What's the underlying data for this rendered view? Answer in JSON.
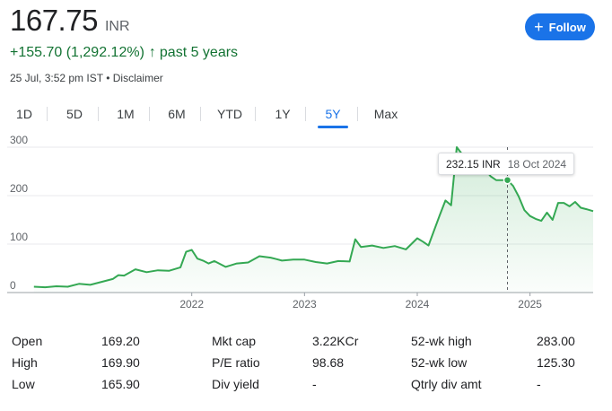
{
  "quote": {
    "price": "167.75",
    "currency": "INR",
    "change": "+155.70 (1,292.12%)",
    "change_arrow": "↑",
    "change_period": "past 5 years",
    "timestamp": "25 Jul, 3:52 pm IST",
    "separator": "•",
    "disclaimer": "Disclaimer"
  },
  "follow": {
    "icon": "plus-icon",
    "glyph": "+",
    "label": "Follow"
  },
  "ranges": {
    "items": [
      "1D",
      "5D",
      "1M",
      "6M",
      "YTD",
      "1Y",
      "5Y",
      "Max"
    ],
    "active": "5Y"
  },
  "tooltip": {
    "price": "232.15 INR",
    "date": "18 Oct 2024"
  },
  "colors": {
    "line": "#34a853",
    "accent": "#1a73e8",
    "positive": "#137333"
  },
  "chart_data": {
    "type": "area",
    "y_ticks": [
      "0",
      "100",
      "200",
      "300"
    ],
    "x_ticks": [
      "2022",
      "2023",
      "2024",
      "2025"
    ],
    "ylim": [
      0,
      300
    ],
    "x_tick_positions": [
      2022.0,
      2023.0,
      2024.0,
      2025.0
    ],
    "xlim": [
      2020.57,
      2025.56
    ],
    "grid": true,
    "hover_x": 2024.8,
    "series": [
      {
        "x": [
          2020.6,
          2020.7,
          2020.8,
          2020.9,
          2021.0,
          2021.1,
          2021.2,
          2021.3,
          2021.35,
          2021.4,
          2021.5,
          2021.6,
          2021.7,
          2021.8,
          2021.9,
          2021.95,
          2022.0,
          2022.05,
          2022.1,
          2022.15,
          2022.2,
          2022.3,
          2022.4,
          2022.5,
          2022.6,
          2022.7,
          2022.75,
          2022.8,
          2022.9,
          2023.0,
          2023.1,
          2023.2,
          2023.3,
          2023.4,
          2023.45,
          2023.5,
          2023.6,
          2023.7,
          2023.8,
          2023.9,
          2024.0,
          2024.05,
          2024.1,
          2024.2,
          2024.25,
          2024.3,
          2024.35,
          2024.4,
          2024.42,
          2024.45,
          2024.48,
          2024.52,
          2024.55,
          2024.6,
          2024.65,
          2024.7,
          2024.75,
          2024.8,
          2024.85,
          2024.9,
          2024.95,
          2025.0,
          2025.05,
          2025.1,
          2025.15,
          2025.2,
          2025.25,
          2025.3,
          2025.35,
          2025.4,
          2025.45,
          2025.5,
          2025.56
        ],
        "y": [
          12,
          11,
          13,
          12,
          18,
          16,
          22,
          28,
          36,
          35,
          48,
          42,
          46,
          45,
          52,
          84,
          88,
          70,
          66,
          60,
          65,
          53,
          60,
          62,
          75,
          72,
          69,
          66,
          68,
          68,
          63,
          60,
          65,
          64,
          110,
          94,
          97,
          92,
          96,
          89,
          112,
          105,
          97,
          160,
          190,
          180,
          300,
          285,
          275,
          265,
          255,
          245,
          262,
          255,
          240,
          232,
          232,
          232,
          220,
          198,
          170,
          158,
          152,
          148,
          165,
          150,
          185,
          185,
          178,
          187,
          175,
          172,
          168
        ]
      }
    ]
  },
  "stats": [
    {
      "label": "Open",
      "value": "169.20"
    },
    {
      "label": "High",
      "value": "169.90"
    },
    {
      "label": "Low",
      "value": "165.90"
    },
    {
      "label": "Mkt cap",
      "value": "3.22KCr"
    },
    {
      "label": "P/E ratio",
      "value": "98.68"
    },
    {
      "label": "Div yield",
      "value": "-"
    },
    {
      "label": "52-wk high",
      "value": "283.00"
    },
    {
      "label": "52-wk low",
      "value": "125.30"
    },
    {
      "label": "Qtrly div amt",
      "value": "-"
    }
  ]
}
